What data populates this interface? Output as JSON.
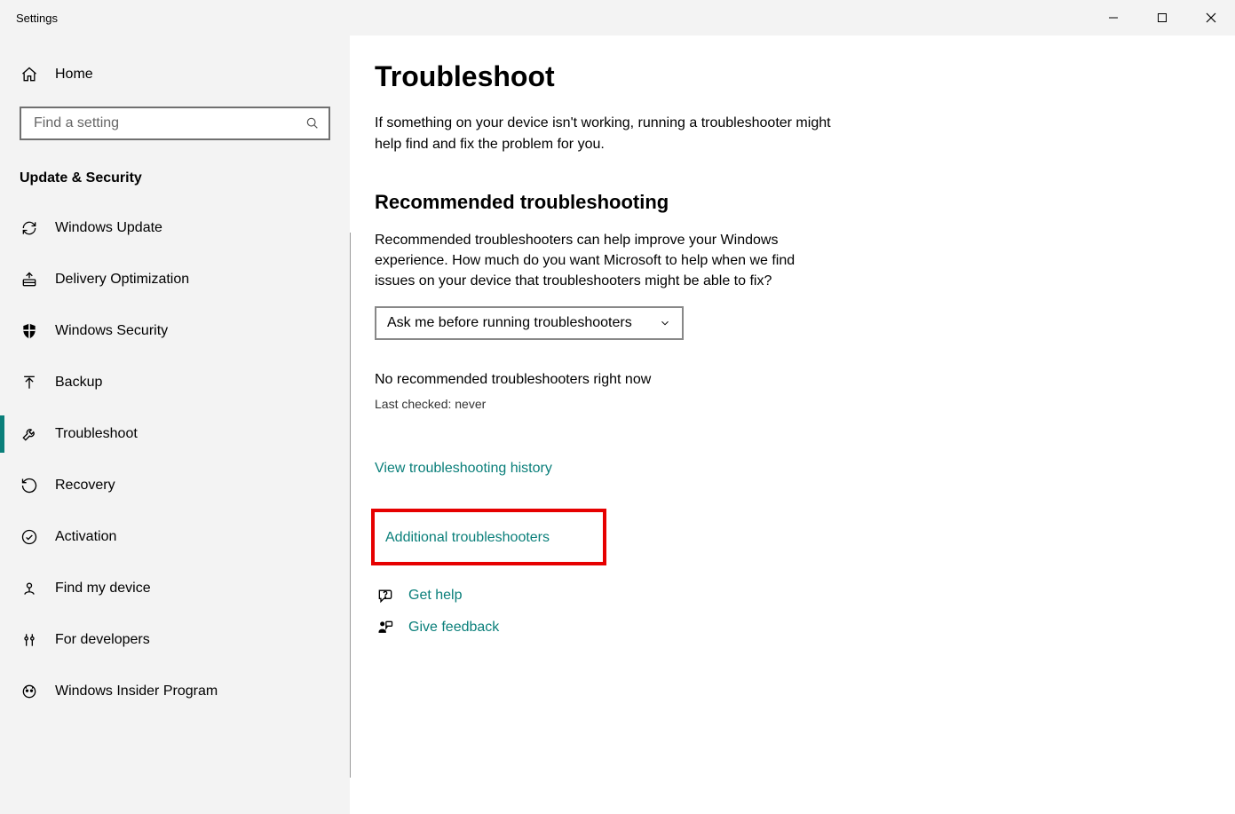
{
  "window": {
    "title": "Settings"
  },
  "sidebar": {
    "home_label": "Home",
    "search_placeholder": "Find a setting",
    "section_label": "Update & Security",
    "items": [
      {
        "label": "Windows Update"
      },
      {
        "label": "Delivery Optimization"
      },
      {
        "label": "Windows Security"
      },
      {
        "label": "Backup"
      },
      {
        "label": "Troubleshoot"
      },
      {
        "label": "Recovery"
      },
      {
        "label": "Activation"
      },
      {
        "label": "Find my device"
      },
      {
        "label": "For developers"
      },
      {
        "label": "Windows Insider Program"
      }
    ],
    "selected_index": 4
  },
  "main": {
    "title": "Troubleshoot",
    "description": "If something on your device isn't working, running a troubleshooter might help find and fix the problem for you.",
    "recommended": {
      "heading": "Recommended troubleshooting",
      "description": "Recommended troubleshooters can help improve your Windows experience. How much do you want Microsoft to help when we find issues on your device that troubleshooters might be able to fix?",
      "dropdown_value": "Ask me before running troubleshooters",
      "no_rec_text": "No recommended troubleshooters right now",
      "last_checked": "Last checked: never"
    },
    "links": {
      "history": "View troubleshooting history",
      "additional": "Additional troubleshooters",
      "get_help": "Get help",
      "give_feedback": "Give feedback"
    }
  }
}
